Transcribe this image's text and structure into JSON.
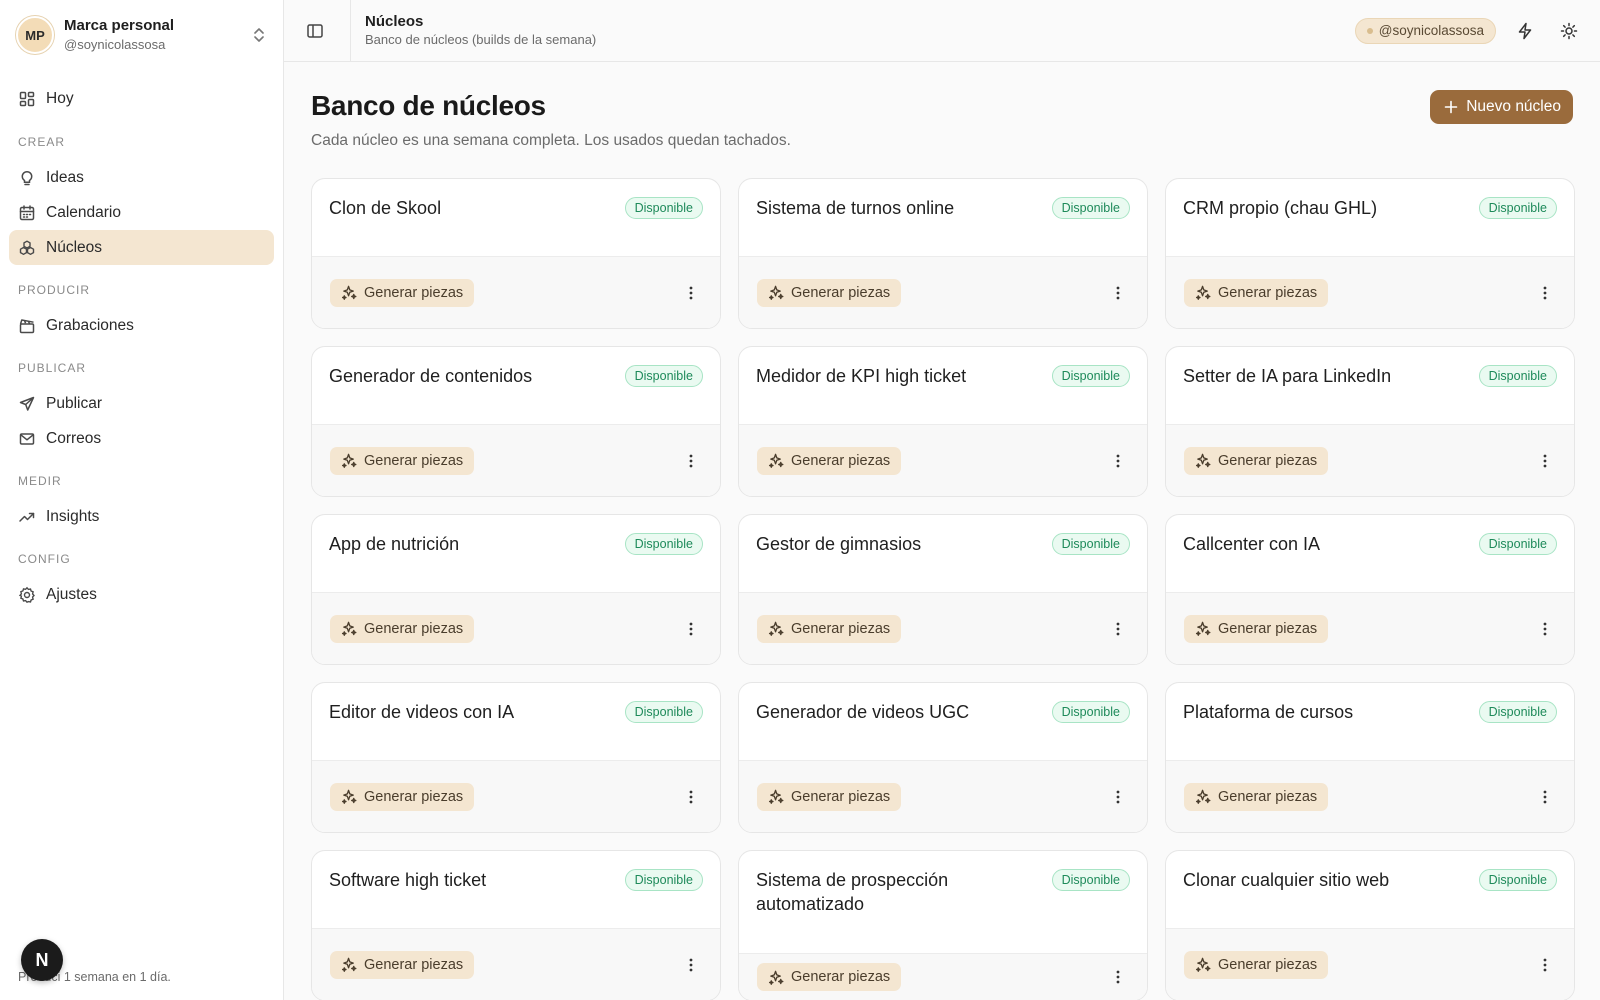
{
  "account": {
    "initials": "MP",
    "name": "Marca personal",
    "handle": "@soynicolassosa"
  },
  "nav": {
    "home": "Hoy",
    "sections": {
      "crear": "CREAR",
      "producir": "PRODUCIR",
      "publicar": "PUBLICAR",
      "medir": "MEDIR",
      "config": "CONFIG"
    },
    "ideas": "Ideas",
    "calendario": "Calendario",
    "nucleos": "Núcleos",
    "grabaciones": "Grabaciones",
    "publicar": "Publicar",
    "correos": "Correos",
    "insights": "Insights",
    "ajustes": "Ajustes"
  },
  "floating_badge": "N",
  "footer_text": "Produci 1 semana en 1 día.",
  "topbar": {
    "title": "Núcleos",
    "subtitle": "Banco de núcleos (builds de la semana)",
    "handle": "@soynicolassosa"
  },
  "page": {
    "title": "Banco de núcleos",
    "subtitle": "Cada núcleo es una semana completa. Los usados quedan tachados.",
    "new_button": "Nuevo núcleo"
  },
  "card_status": "Disponible",
  "card_action": "Generar piezas",
  "cards": [
    {
      "title": "Clon de Skool",
      "status": "Disponible",
      "action": "Generar piezas"
    },
    {
      "title": "Sistema de turnos online",
      "status": "Disponible",
      "action": "Generar piezas"
    },
    {
      "title": "CRM propio (chau GHL)",
      "status": "Disponible",
      "action": "Generar piezas"
    },
    {
      "title": "Generador de contenidos",
      "status": "Disponible",
      "action": "Generar piezas"
    },
    {
      "title": "Medidor de KPI high ticket",
      "status": "Disponible",
      "action": "Generar piezas"
    },
    {
      "title": "Setter de IA para LinkedIn",
      "status": "Disponible",
      "action": "Generar piezas"
    },
    {
      "title": "App de nutrición",
      "status": "Disponible",
      "action": "Generar piezas"
    },
    {
      "title": "Gestor de gimnasios",
      "status": "Disponible",
      "action": "Generar piezas"
    },
    {
      "title": "Callcenter con IA",
      "status": "Disponible",
      "action": "Generar piezas"
    },
    {
      "title": "Editor de videos con IA",
      "status": "Disponible",
      "action": "Generar piezas"
    },
    {
      "title": "Generador de videos UGC",
      "status": "Disponible",
      "action": "Generar piezas"
    },
    {
      "title": "Plataforma de cursos",
      "status": "Disponible",
      "action": "Generar piezas"
    },
    {
      "title": "Software high ticket",
      "status": "Disponible",
      "action": "Generar piezas"
    },
    {
      "title": "Sistema de prospección automatizado",
      "status": "Disponible",
      "action": "Generar piezas"
    },
    {
      "title": "Clonar cualquier sitio web",
      "status": "Disponible",
      "action": "Generar piezas"
    }
  ],
  "colors": {
    "accent": "#9a6b3c",
    "accent_soft": "#f4e6d1",
    "status_green": "#1e8a5a"
  },
  "icons": {
    "home": "grid-icon",
    "ideas": "lightbulb-icon",
    "calendar": "calendar-icon",
    "nucleos": "cubes-icon",
    "grabaciones": "clapperboard-icon",
    "publicar": "send-icon",
    "correos": "mail-icon",
    "insights": "trend-up-icon",
    "ajustes": "gear-icon",
    "generate": "sparkles-icon",
    "more": "more-vertical-icon"
  }
}
